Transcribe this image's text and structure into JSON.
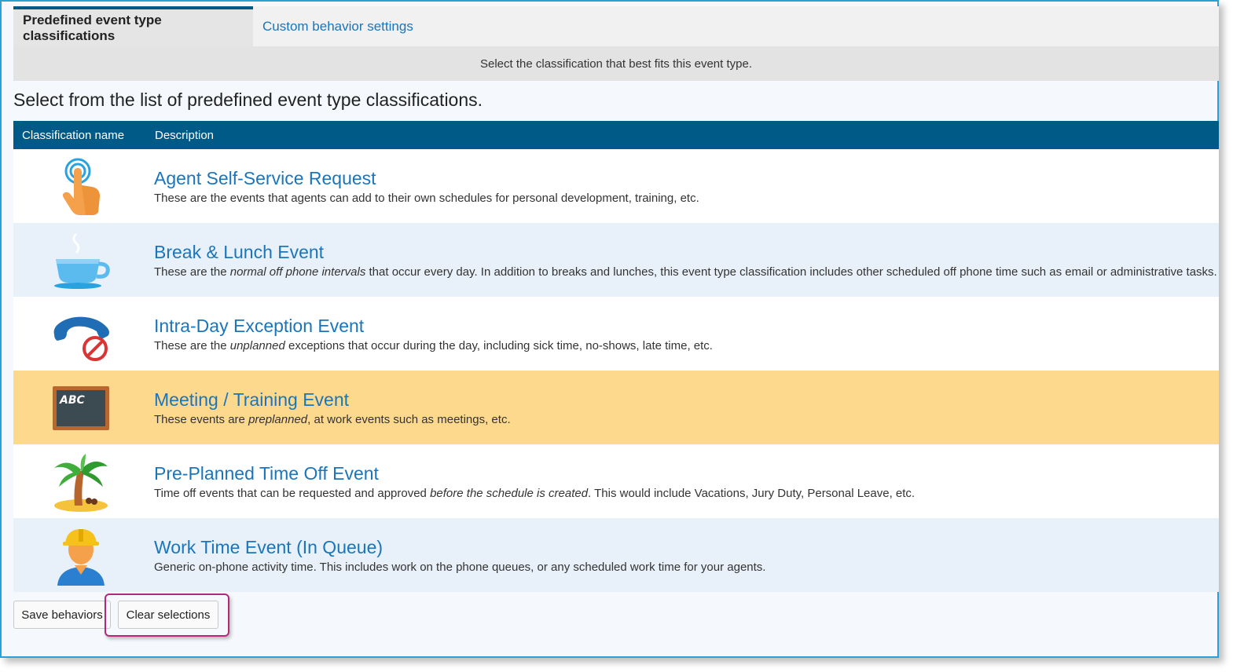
{
  "tabs": [
    {
      "label": "Predefined event type classifications",
      "active": true
    },
    {
      "label": "Custom behavior settings",
      "active": false
    }
  ],
  "hint": "Select the classification that best fits this event type.",
  "heading": "Select from the list of predefined event type classifications.",
  "table": {
    "columns": [
      "Classification name",
      "Description"
    ],
    "rows": [
      {
        "icon": "touch-hand-icon",
        "name": "Agent Self-Service Request",
        "desc": [
          {
            "text": "These are the events that agents can add to their own schedules for personal development, training, etc.",
            "italic": false
          }
        ]
      },
      {
        "icon": "coffee-cup-icon",
        "name": "Break & Lunch Event",
        "desc": [
          {
            "text": "These are the ",
            "italic": false
          },
          {
            "text": "normal off phone intervals",
            "italic": true
          },
          {
            "text": " that occur every day. In addition to breaks and lunches, this event type classification includes other scheduled off phone time such as email or administrative tasks.",
            "italic": false
          }
        ]
      },
      {
        "icon": "phone-prohibited-icon",
        "name": "Intra-Day Exception Event",
        "desc": [
          {
            "text": "These are the ",
            "italic": false
          },
          {
            "text": "unplanned",
            "italic": true
          },
          {
            "text": " exceptions that occur during the day, including sick time, no-shows, late time, etc.",
            "italic": false
          }
        ]
      },
      {
        "icon": "chalkboard-icon",
        "name": "Meeting / Training Event",
        "selected": true,
        "desc": [
          {
            "text": "These events are ",
            "italic": false
          },
          {
            "text": "preplanned",
            "italic": true
          },
          {
            "text": ", at work events such as meetings, etc.",
            "italic": false
          }
        ]
      },
      {
        "icon": "palm-tree-icon",
        "name": "Pre-Planned Time Off Event",
        "desc": [
          {
            "text": "Time off events that can be requested and approved ",
            "italic": false
          },
          {
            "text": "before the schedule is created",
            "italic": true
          },
          {
            "text": ". This would include Vacations, Jury Duty, Personal Leave, etc.",
            "italic": false
          }
        ]
      },
      {
        "icon": "worker-icon",
        "name": "Work Time Event (In Queue)",
        "desc": [
          {
            "text": "Generic on-phone activity time. This includes work on the phone queues, or any scheduled work time for your agents.",
            "italic": false
          }
        ]
      }
    ]
  },
  "chalkboard_text": "ABC",
  "buttons": {
    "save": "Save behaviors",
    "clear": "Clear selections"
  },
  "colors": {
    "accent": "#005a87",
    "link": "#1a75bb",
    "selected_row": "#fdd98e",
    "highlight_border": "#b4287a"
  }
}
